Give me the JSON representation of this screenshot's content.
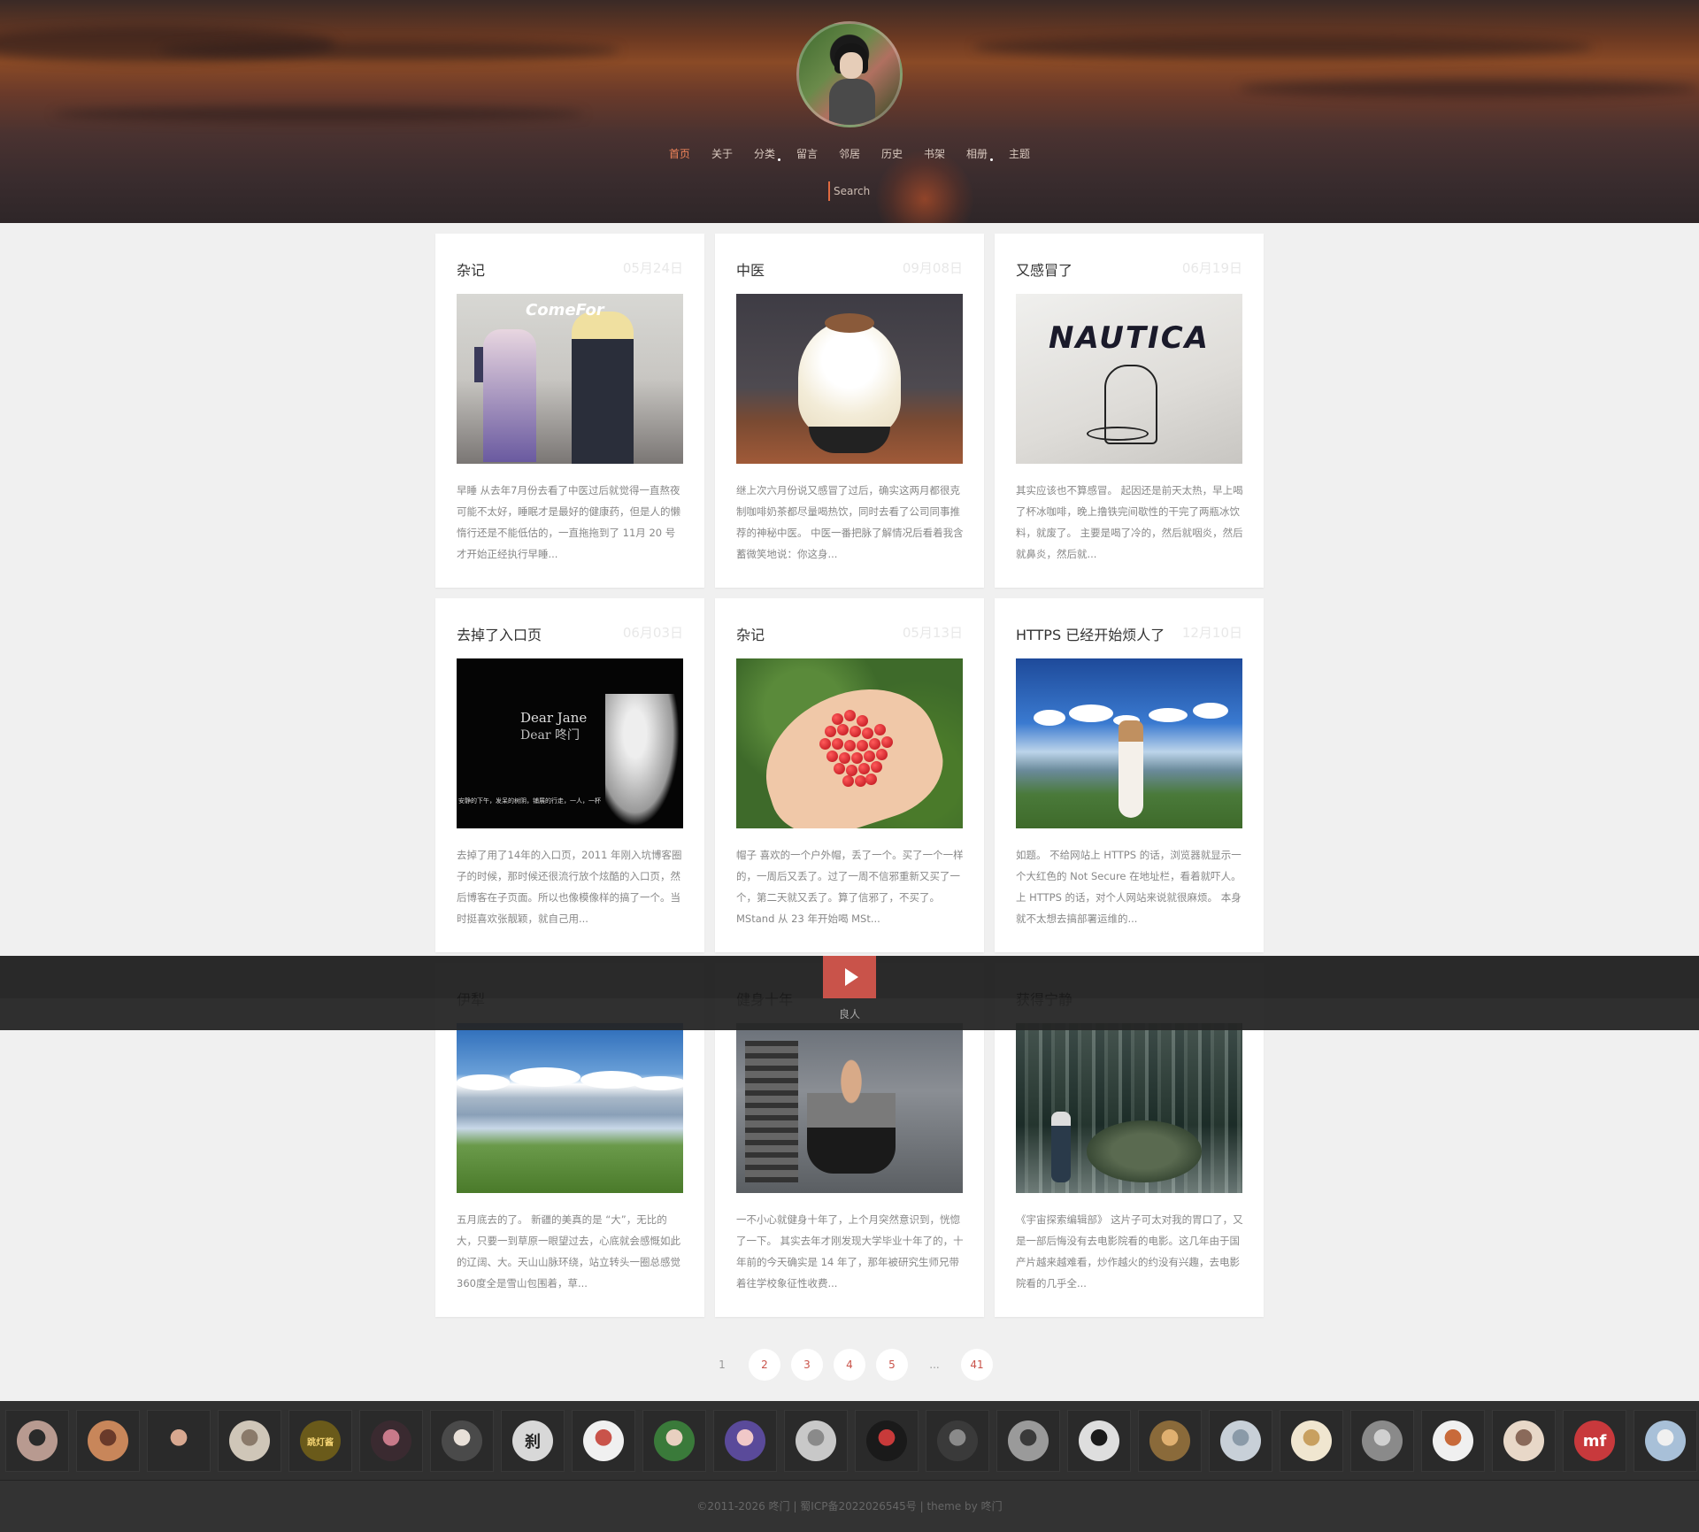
{
  "header": {
    "nav": [
      {
        "label": "首页",
        "active": true,
        "sub": false
      },
      {
        "label": "关于",
        "active": false,
        "sub": false
      },
      {
        "label": "分类",
        "active": false,
        "sub": true
      },
      {
        "label": "留言",
        "active": false,
        "sub": false
      },
      {
        "label": "邻居",
        "active": false,
        "sub": false
      },
      {
        "label": "历史",
        "active": false,
        "sub": false
      },
      {
        "label": "书架",
        "active": false,
        "sub": false
      },
      {
        "label": "相册",
        "active": false,
        "sub": true
      },
      {
        "label": "主题",
        "active": false,
        "sub": false
      }
    ],
    "search_placeholder": "Search"
  },
  "posts": [
    {
      "title": "杂记",
      "date": "05月24日",
      "photo": "ph1",
      "excerpt": "早睡 从去年7月份去看了中医过后就觉得一直熬夜可能不太好，睡眠才是最好的健康药，但是人的懒惰行还是不能低估的，一直拖拖到了 11月 20 号才开始正经执行早睡..."
    },
    {
      "title": "中医",
      "date": "09月08日",
      "photo": "ph2",
      "excerpt": "继上次六月份说又感冒了过后，确实这两月都很克制咖啡奶茶都尽量喝热饮，同时去看了公司同事推荐的神秘中医。 中医一番把脉了解情况后看着我含蓄微笑地说：你这身..."
    },
    {
      "title": "又感冒了",
      "date": "06月19日",
      "photo": "ph3",
      "photo_text": "NAUTICA",
      "excerpt": "其实应该也不算感冒。 起因还是前天太热，早上喝了杯冰咖啡，晚上撸铁完间歇性的干完了两瓶冰饮料，就废了。 主要是喝了冷的，然后就咽炎，然后就鼻炎，然后就..."
    },
    {
      "title": "去掉了入口页",
      "date": "06月03日",
      "photo": "ph4",
      "photo_text": "Dear Jane",
      "photo_text2": "Dear 咚门",
      "photo_caption": "安静的下午，发呆的树阴，铺展的行走，一人，一杯",
      "excerpt": "去掉了用了14年的入口页，2011 年刚入坑博客圈子的时候，那时候还很流行放个炫酷的入口页，然后博客在子页面。所以也像模像样的搞了一个。当时挺喜欢张靓颖，就自己用..."
    },
    {
      "title": "杂记",
      "date": "05月13日",
      "photo": "ph5",
      "excerpt": "帽子 喜欢的一个户外帽，丢了一个。买了一个一样的，一周后又丢了。过了一周不信邪重新又买了一个，第二天就又丢了。算了信邪了，不买了。 MStand 从 23 年开始喝 MSt..."
    },
    {
      "title": "HTTPS 已经开始烦人了",
      "date": "12月10日",
      "photo": "ph6",
      "excerpt": "如题。 不给网站上 HTTPS 的话，浏览器就显示一个大红色的 Not Secure 在地址栏，看着就吓人。 上 HTTPS 的话，对个人网站来说就很麻烦。 本身就不太想去搞部署运维的..."
    },
    {
      "title": "伊犁",
      "date": "",
      "photo": "ph7",
      "excerpt": "五月底去的了。 新疆的美真的是 “大”，无比的大，只要一到草原一眼望过去，心底就会感慨如此的辽阔、大。天山山脉环绕，站立转头一圈总感觉 360度全是雪山包围着，草..."
    },
    {
      "title": "健身十年",
      "date": "",
      "photo": "ph8",
      "excerpt": "一不小心就健身十年了，上个月突然意识到，恍惚了一下。 其实去年才刚发现大学毕业十年了的，十年前的今天确实是 14 年了，那年被研究生师兄带着往学校象征性收费..."
    },
    {
      "title": "获得宁静",
      "date": "",
      "photo": "ph9",
      "excerpt": "《宇宙探索编辑部》 这片子可太对我的胃口了，又是一部后悔没有去电影院看的电影。这几年由于国产片越来越难看，炒作越火的约没有兴趣，去电影院看的几乎全..."
    }
  ],
  "player": {
    "song": "良人"
  },
  "pagination": [
    "1",
    "2",
    "3",
    "4",
    "5",
    "...",
    "41"
  ],
  "friends": [
    {
      "color": "#b89a90",
      "hair": "#2a2a2a"
    },
    {
      "color": "#c8865a",
      "hair": "#6a3a2a"
    },
    {
      "color": "#2a2a2a",
      "hair": "#d8a890"
    },
    {
      "color": "#cfc6b8",
      "hair": "#8a7a6a"
    },
    {
      "color": "#6a5a1a",
      "hair": "#e0c060",
      "text": "跳灯酱"
    },
    {
      "color": "#3a2a30",
      "hair": "#c87a8a"
    },
    {
      "color": "#4a4a4a",
      "hair": "#e8e0d8"
    },
    {
      "color": "#d8d8d8",
      "hair": "#222",
      "text": "刹"
    },
    {
      "color": "#f0f0f0",
      "hair": "#c9534a"
    },
    {
      "color": "#3a7a3a",
      "hair": "#e8d0c0"
    },
    {
      "color": "#5a4a9a",
      "hair": "#f0c8c8"
    },
    {
      "color": "#c8c8c8",
      "hair": "#8a8a8a"
    },
    {
      "color": "#1a1a1a",
      "hair": "#c83a3a"
    },
    {
      "color": "#3a3a3a",
      "hair": "#8a8a8a"
    },
    {
      "color": "#9a9a9a",
      "hair": "#3a3a3a"
    },
    {
      "color": "#dedede",
      "hair": "#1a1a1a"
    },
    {
      "color": "#8a6a3a",
      "hair": "#e0b070"
    },
    {
      "color": "#c8d0d8",
      "hair": "#8a9aa8"
    },
    {
      "color": "#f0e6d0",
      "hair": "#c8a060"
    },
    {
      "color": "#8a8a8a",
      "hair": "#d0d0d0"
    },
    {
      "color": "#f0f0f0",
      "hair": "#c86a3a"
    },
    {
      "color": "#e8d8c8",
      "hair": "#8a6a5a"
    },
    {
      "color": "#c8393c",
      "hair": "#c8393c",
      "text": "mf"
    },
    {
      "color": "#a8c0d8",
      "hair": "#f0f0f0"
    }
  ],
  "footer": {
    "text": "©2011-2026  咚门  |  蜀ICP备2022026545号  |  theme by 咚门"
  }
}
